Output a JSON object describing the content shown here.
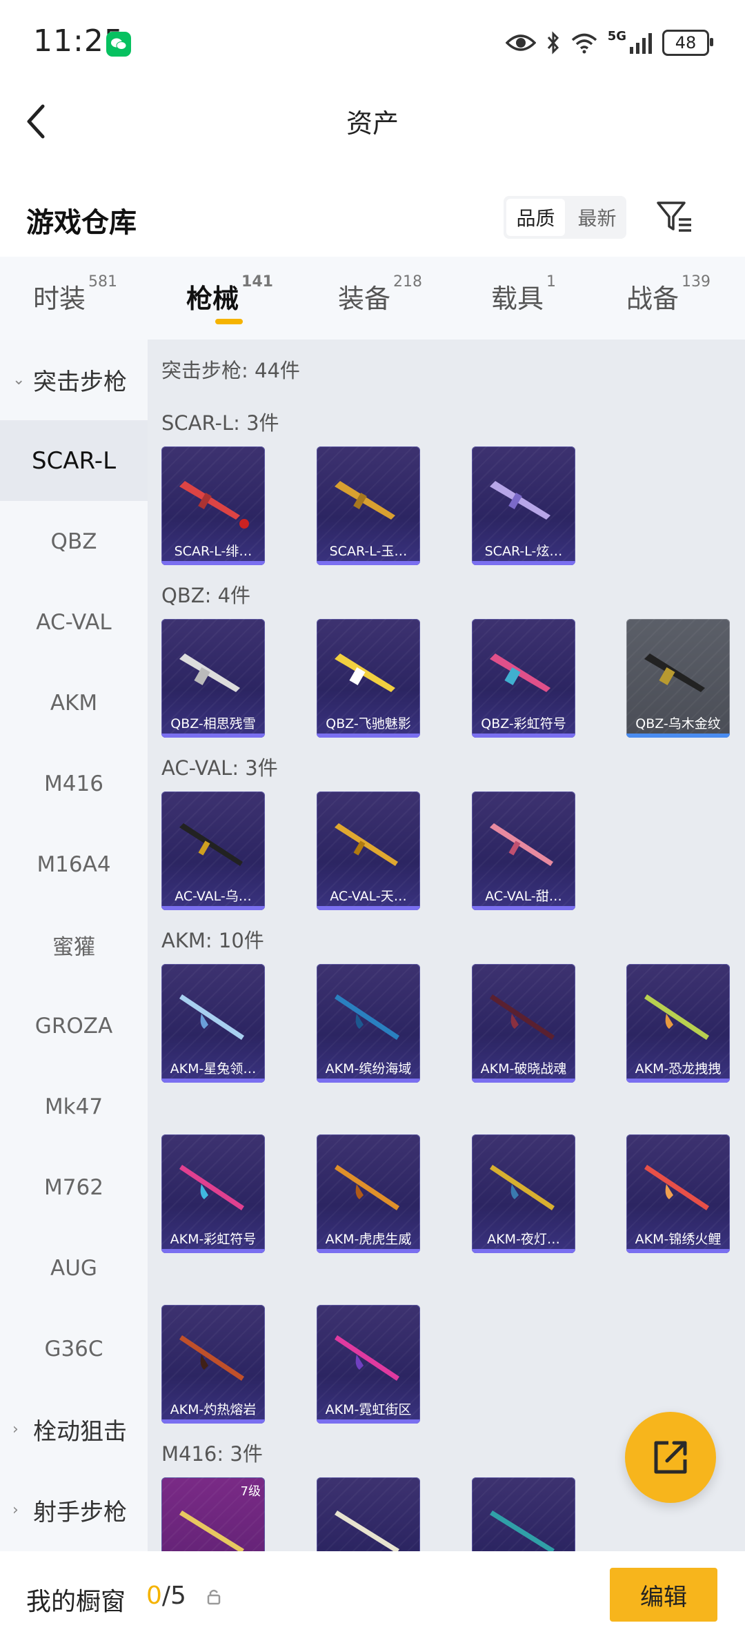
{
  "status_bar": {
    "time": "11:25",
    "network": "5G",
    "battery": "48"
  },
  "header": {
    "title": "资产"
  },
  "warehouse": {
    "title": "游戏仓库",
    "sort_options": [
      "品质",
      "最新"
    ],
    "active_sort": "品质"
  },
  "tabs": [
    {
      "label": "时装",
      "count": "581"
    },
    {
      "label": "枪械",
      "count": "141"
    },
    {
      "label": "装备",
      "count": "218"
    },
    {
      "label": "载具",
      "count": "1"
    },
    {
      "label": "战备",
      "count": "139"
    }
  ],
  "sidebar": {
    "group_open": "突击步枪",
    "items": [
      "SCAR-L",
      "QBZ",
      "AC-VAL",
      "AKM",
      "M416",
      "M16A4",
      "蜜獾",
      "GROZA",
      "Mk47",
      "M762",
      "AUG",
      "G36C"
    ],
    "active_item": "SCAR-L",
    "group_closed_1": "栓动狙击",
    "group_closed_2": "射手步枪"
  },
  "content": {
    "category_total": "突击步枪: 44件",
    "sections": [
      {
        "title": "SCAR-L: 3件",
        "items": [
          "SCAR-L-绯…",
          "SCAR-L-玉…",
          "SCAR-L-炫…"
        ]
      },
      {
        "title": "QBZ: 4件",
        "items": [
          "QBZ-相思残雪",
          "QBZ-飞驰魅影",
          "QBZ-彩虹符号",
          "QBZ-乌木金纹"
        ]
      },
      {
        "title": "AC-VAL: 3件",
        "items": [
          "AC-VAL-乌…",
          "AC-VAL-天…",
          "AC-VAL-甜…"
        ]
      },
      {
        "title": "AKM: 10件",
        "items": [
          "AKM-星兔领…",
          "AKM-缤纷海域",
          "AKM-破晓战魂",
          "AKM-恐龙拽拽",
          "AKM-彩虹符号",
          "AKM-虎虎生威",
          "AKM-夜灯…",
          "AKM-锦绣火鲤",
          "AKM-灼热熔岩",
          "AKM-霓虹街区"
        ]
      },
      {
        "title": "M416: 3件",
        "level_badge": "7级"
      }
    ]
  },
  "bottom_bar": {
    "label": "我的橱窗",
    "current": "0",
    "max": "/5",
    "edit_label": "编辑"
  },
  "colors": {
    "accent": "#f7b51c",
    "card_purple": "#2c2562",
    "card_gray": "#4a4d56"
  }
}
